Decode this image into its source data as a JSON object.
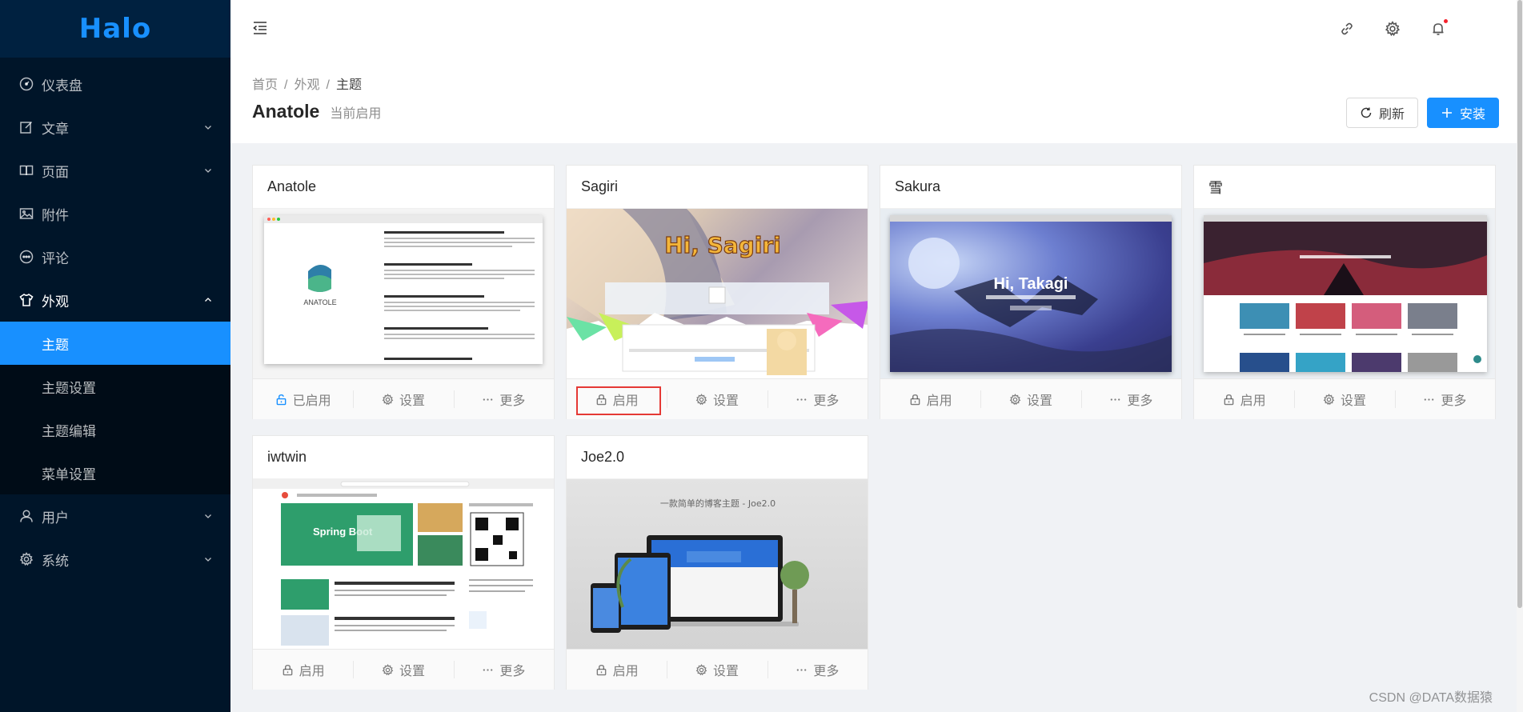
{
  "app": {
    "logo": "Halo"
  },
  "sidebar": {
    "items": [
      {
        "label": "仪表盘",
        "icon": "dashboard-icon",
        "has_children": false
      },
      {
        "label": "文章",
        "icon": "form-icon",
        "has_children": true
      },
      {
        "label": "页面",
        "icon": "read-icon",
        "has_children": true
      },
      {
        "label": "附件",
        "icon": "picture-icon",
        "has_children": false
      },
      {
        "label": "评论",
        "icon": "message-icon",
        "has_children": false
      },
      {
        "label": "外观",
        "icon": "skin-icon",
        "has_children": true,
        "open": true,
        "children": [
          "主题",
          "主题设置",
          "主题编辑",
          "菜单设置"
        ],
        "active_child": "主题"
      },
      {
        "label": "用户",
        "icon": "user-icon",
        "has_children": true
      },
      {
        "label": "系统",
        "icon": "setting-icon",
        "has_children": true
      }
    ]
  },
  "header": {
    "icons": [
      "menu-fold-icon",
      "link-icon",
      "setting-icon",
      "bell-icon"
    ]
  },
  "page": {
    "breadcrumb": [
      "首页",
      "外观",
      "主题"
    ],
    "title": "Anatole",
    "subtitle": "当前启用",
    "refresh_label": "刷新",
    "install_label": "安装"
  },
  "themes": [
    {
      "name": "Anatole",
      "enable_label": "已启用",
      "enabled": true,
      "settings_label": "设置",
      "more_label": "更多"
    },
    {
      "name": "Sagiri",
      "enable_label": "启用",
      "enabled": false,
      "settings_label": "设置",
      "more_label": "更多",
      "highlighted": true
    },
    {
      "name": "Sakura",
      "enable_label": "启用",
      "enabled": false,
      "settings_label": "设置",
      "more_label": "更多"
    },
    {
      "name": "雪",
      "enable_label": "启用",
      "enabled": false,
      "settings_label": "设置",
      "more_label": "更多"
    },
    {
      "name": "iwtwin",
      "enable_label": "启用",
      "enabled": false,
      "settings_label": "设置",
      "more_label": "更多"
    },
    {
      "name": "Joe2.0",
      "enable_label": "启用",
      "enabled": false,
      "settings_label": "设置",
      "more_label": "更多"
    }
  ],
  "covers": {
    "sagiri_text": "Hi, Sagiri",
    "sakura_text": "Hi, Takagi",
    "joe_text": "一款简单的博客主题 - Joe2.0",
    "anatole_logo": "ANATOLE",
    "iwtwin_text": "Spring Boot"
  },
  "watermark": "CSDN @DATA数据猿",
  "colors": {
    "primary": "#1890ff",
    "sidebar_bg": "#001529",
    "highlight": "#e53935"
  }
}
